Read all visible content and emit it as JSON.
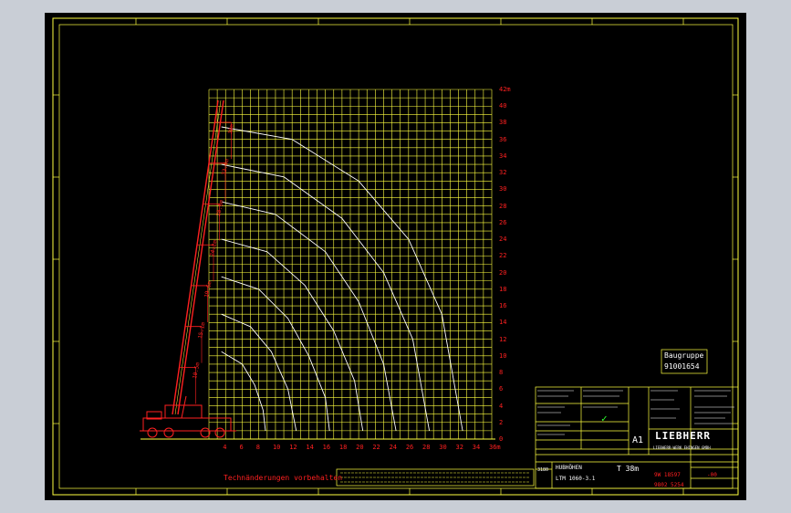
{
  "chart_data": {
    "type": "line",
    "title": "",
    "x_unit": "m",
    "y_unit": "m",
    "x_ticks": [
      4,
      6,
      8,
      10,
      12,
      14,
      16,
      18,
      20,
      22,
      24,
      26,
      28,
      30,
      32,
      34,
      36
    ],
    "x_tick_labels": [
      "4",
      "6",
      "8",
      "10",
      "12",
      "14",
      "16",
      "18",
      "20",
      "22",
      "24",
      "26",
      "28",
      "30",
      "32",
      "34",
      "36m"
    ],
    "y_ticks": [
      0,
      2,
      4,
      6,
      8,
      10,
      12,
      14,
      16,
      18,
      20,
      22,
      24,
      26,
      28,
      30,
      32,
      34,
      36,
      38,
      40,
      42
    ],
    "y_tick_labels": [
      "0",
      "2",
      "4",
      "6",
      "8",
      "10",
      "12",
      "14",
      "16",
      "18",
      "20",
      "22",
      "24",
      "26",
      "28",
      "30",
      "32",
      "34",
      "36",
      "38",
      "40",
      "42m"
    ],
    "xlim": [
      2,
      36
    ],
    "ylim": [
      0,
      42
    ],
    "grid": true,
    "boom_sections": [
      "38m",
      "33.4m",
      "28.8m",
      "24.2m",
      "19.6m",
      "15.1m",
      "10.5m"
    ],
    "series": [
      {
        "name": "38m",
        "x": [
          3.5,
          12,
          20,
          26,
          30,
          32.5
        ],
        "y": [
          37.5,
          36,
          31,
          24,
          15,
          1
        ]
      },
      {
        "name": "33.4m",
        "x": [
          3.5,
          11,
          18,
          23,
          26.5,
          28.5
        ],
        "y": [
          33,
          31.5,
          26.5,
          20,
          12,
          1
        ]
      },
      {
        "name": "28.8m",
        "x": [
          3.5,
          10,
          16,
          20,
          23,
          24.5
        ],
        "y": [
          28.5,
          27,
          22.5,
          16.5,
          9,
          1
        ]
      },
      {
        "name": "24.2m",
        "x": [
          3.5,
          9,
          13.5,
          17,
          19.5,
          20.5
        ],
        "y": [
          24,
          22.5,
          18.5,
          13,
          7,
          1
        ]
      },
      {
        "name": "19.6m",
        "x": [
          3.5,
          8,
          11.5,
          14,
          16,
          16.5
        ],
        "y": [
          19.5,
          18,
          14.5,
          10,
          5,
          1
        ]
      },
      {
        "name": "15.1m",
        "x": [
          3.5,
          7,
          9.5,
          11.5,
          12.5
        ],
        "y": [
          15,
          13.5,
          10.5,
          6,
          1
        ]
      },
      {
        "name": "10.5m",
        "x": [
          3.5,
          6,
          7.5,
          8.5,
          8.8
        ],
        "y": [
          10.5,
          9,
          6.5,
          3.5,
          1
        ]
      }
    ]
  },
  "notes": {
    "tech_changes": "Technänderungen vorbehalten"
  },
  "title_block": {
    "group_label": "Baugruppe",
    "group_number": "91001654",
    "sheet_size": "A1",
    "brand": "LIEBHERR",
    "brand_sub": "LIEBHERR-WERK EHINGEN GMBH",
    "title_line1": "HUBHÖHEN",
    "title_line2": "LTM 1060-3.1",
    "boom_label": "T 38m",
    "doc_number": "9802 5254",
    "part_number": "9W 18597",
    "index": "-00",
    "left_code": "3180",
    "check_mark": "✓"
  },
  "colors": {
    "background": "#000000",
    "grid": "#ffff40",
    "frame": "#ffff40",
    "axis_labels": "#ff2020",
    "curves": "#ffffff",
    "boom": "#ff2020",
    "check": "#30ff30"
  }
}
